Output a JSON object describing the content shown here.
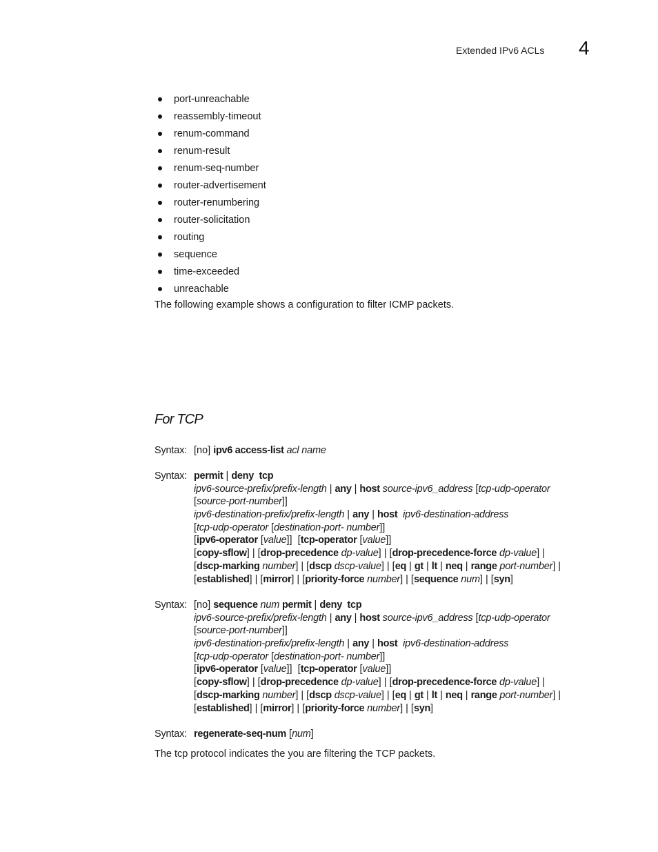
{
  "header": {
    "title": "Extended IPv6 ACLs",
    "chapter_number": "4"
  },
  "bullet_items": [
    "port-unreachable",
    "reassembly-timeout",
    "renum-command",
    "renum-result",
    "renum-seq-number",
    "router-advertisement",
    "router-renumbering",
    "router-solicitation",
    "routing",
    "sequence",
    "time-exceeded",
    "unreachable"
  ],
  "example_intro": "The following example shows a configuration to filter ICMP packets.",
  "section": {
    "heading": "For TCP",
    "syntax_label": "Syntax:",
    "syntax_blocks": [
      {
        "lines": [
          [
            [
              "r",
              "[no] "
            ],
            [
              "b",
              "ipv6 access-list"
            ],
            [
              "i",
              " acl name"
            ]
          ]
        ]
      },
      {
        "lines": [
          [
            [
              "b",
              "permit"
            ],
            [
              "r",
              " | "
            ],
            [
              "b",
              "deny  tcp"
            ]
          ],
          [
            [
              "i",
              "ipv6-source-prefix/prefix-length"
            ],
            [
              "r",
              " | "
            ],
            [
              "b",
              "any"
            ],
            [
              "r",
              " | "
            ],
            [
              "b",
              "host"
            ],
            [
              "i",
              " source-ipv6_address"
            ],
            [
              "r",
              " ["
            ],
            [
              "i",
              "tcp-udp-operator"
            ]
          ],
          [
            [
              "r",
              "["
            ],
            [
              "i",
              "source-port-number"
            ],
            [
              "r",
              "]]"
            ]
          ],
          [
            [
              "i",
              "ipv6-destination-prefix/prefix-length"
            ],
            [
              "r",
              " | "
            ],
            [
              "b",
              "any"
            ],
            [
              "r",
              " | "
            ],
            [
              "b",
              "host"
            ],
            [
              "i",
              "  ipv6-destination-address"
            ]
          ],
          [
            [
              "r",
              "["
            ],
            [
              "i",
              "tcp-udp-operator"
            ],
            [
              "r",
              " ["
            ],
            [
              "i",
              "destination-port- number"
            ],
            [
              "r",
              "]]"
            ]
          ],
          [
            [
              "r",
              "["
            ],
            [
              "b",
              "ipv6-operator"
            ],
            [
              "r",
              " ["
            ],
            [
              "i",
              "value"
            ],
            [
              "r",
              "]]  ["
            ],
            [
              "b",
              "tcp-operator"
            ],
            [
              "r",
              " ["
            ],
            [
              "i",
              "value"
            ],
            [
              "r",
              "]]"
            ]
          ],
          [
            [
              "r",
              "["
            ],
            [
              "b",
              "copy-sflow"
            ],
            [
              "r",
              "] | ["
            ],
            [
              "b",
              "drop-precedence"
            ],
            [
              "i",
              " dp-value"
            ],
            [
              "r",
              "] | ["
            ],
            [
              "b",
              "drop-precedence-force"
            ],
            [
              "i",
              " dp-value"
            ],
            [
              "r",
              "] |"
            ]
          ],
          [
            [
              "r",
              "["
            ],
            [
              "b",
              "dscp-marking"
            ],
            [
              "i",
              " number"
            ],
            [
              "r",
              "] | ["
            ],
            [
              "b",
              "dscp"
            ],
            [
              "i",
              " dscp-value"
            ],
            [
              "r",
              "] | ["
            ],
            [
              "b",
              "eq"
            ],
            [
              "r",
              " | "
            ],
            [
              "b",
              "gt"
            ],
            [
              "r",
              " | "
            ],
            [
              "b",
              "lt"
            ],
            [
              "r",
              " | "
            ],
            [
              "b",
              "neq"
            ],
            [
              "r",
              " | "
            ],
            [
              "b",
              "range"
            ],
            [
              "i",
              " port-number"
            ],
            [
              "r",
              "] |"
            ]
          ],
          [
            [
              "r",
              "["
            ],
            [
              "b",
              "established"
            ],
            [
              "r",
              "] | ["
            ],
            [
              "b",
              "mirror"
            ],
            [
              "r",
              "] | ["
            ],
            [
              "b",
              "priority-force"
            ],
            [
              "i",
              " number"
            ],
            [
              "r",
              "] | ["
            ],
            [
              "b",
              "sequence"
            ],
            [
              "i",
              " num"
            ],
            [
              "r",
              "] | ["
            ],
            [
              "b",
              "syn"
            ],
            [
              "r",
              "]"
            ]
          ]
        ]
      },
      {
        "lines": [
          [
            [
              "r",
              "[no] "
            ],
            [
              "b",
              "sequence"
            ],
            [
              "i",
              " num "
            ],
            [
              "b",
              "permit"
            ],
            [
              "r",
              " | "
            ],
            [
              "b",
              "deny  tcp"
            ]
          ],
          [
            [
              "i",
              "ipv6-source-prefix/prefix-length"
            ],
            [
              "r",
              " | "
            ],
            [
              "b",
              "any"
            ],
            [
              "r",
              " | "
            ],
            [
              "b",
              "host"
            ],
            [
              "i",
              " source-ipv6_address"
            ],
            [
              "r",
              " ["
            ],
            [
              "i",
              "tcp-udp-operator"
            ]
          ],
          [
            [
              "r",
              "["
            ],
            [
              "i",
              "source-port-number"
            ],
            [
              "r",
              "]]"
            ]
          ],
          [
            [
              "i",
              "ipv6-destination-prefix/prefix-length"
            ],
            [
              "r",
              " | "
            ],
            [
              "b",
              "any"
            ],
            [
              "r",
              " | "
            ],
            [
              "b",
              "host"
            ],
            [
              "i",
              "  ipv6-destination-address"
            ]
          ],
          [
            [
              "r",
              "["
            ],
            [
              "i",
              "tcp-udp-operator"
            ],
            [
              "r",
              " ["
            ],
            [
              "i",
              "destination-port- number"
            ],
            [
              "r",
              "]]"
            ]
          ],
          [
            [
              "r",
              "["
            ],
            [
              "b",
              "ipv6-operator"
            ],
            [
              "r",
              " ["
            ],
            [
              "i",
              "value"
            ],
            [
              "r",
              "]]  ["
            ],
            [
              "b",
              "tcp-operator"
            ],
            [
              "r",
              " ["
            ],
            [
              "i",
              "value"
            ],
            [
              "r",
              "]]"
            ]
          ],
          [
            [
              "r",
              "["
            ],
            [
              "b",
              "copy-sflow"
            ],
            [
              "r",
              "] | ["
            ],
            [
              "b",
              "drop-precedence"
            ],
            [
              "i",
              " dp-value"
            ],
            [
              "r",
              "] | ["
            ],
            [
              "b",
              "drop-precedence-force"
            ],
            [
              "i",
              " dp-value"
            ],
            [
              "r",
              "] |"
            ]
          ],
          [
            [
              "r",
              "["
            ],
            [
              "b",
              "dscp-marking"
            ],
            [
              "i",
              " number"
            ],
            [
              "r",
              "] | ["
            ],
            [
              "b",
              "dscp"
            ],
            [
              "i",
              " dscp-value"
            ],
            [
              "r",
              "] | ["
            ],
            [
              "b",
              "eq"
            ],
            [
              "r",
              " | "
            ],
            [
              "b",
              "gt"
            ],
            [
              "r",
              " | "
            ],
            [
              "b",
              "lt"
            ],
            [
              "r",
              " | "
            ],
            [
              "b",
              "neq"
            ],
            [
              "r",
              " | "
            ],
            [
              "b",
              "range"
            ],
            [
              "i",
              " port-number"
            ],
            [
              "r",
              "] |"
            ]
          ],
          [
            [
              "r",
              "["
            ],
            [
              "b",
              "established"
            ],
            [
              "r",
              "] | ["
            ],
            [
              "b",
              "mirror"
            ],
            [
              "r",
              "] | ["
            ],
            [
              "b",
              "priority-force"
            ],
            [
              "i",
              " number"
            ],
            [
              "r",
              "] | ["
            ],
            [
              "b",
              "syn"
            ],
            [
              "r",
              "]"
            ]
          ]
        ]
      },
      {
        "lines": [
          [
            [
              "b",
              "regenerate-seq-num"
            ],
            [
              "r",
              " ["
            ],
            [
              "i",
              "num"
            ],
            [
              "r",
              "]"
            ]
          ]
        ]
      }
    ],
    "closing_text": "The tcp protocol indicates the you are filtering the TCP packets."
  }
}
